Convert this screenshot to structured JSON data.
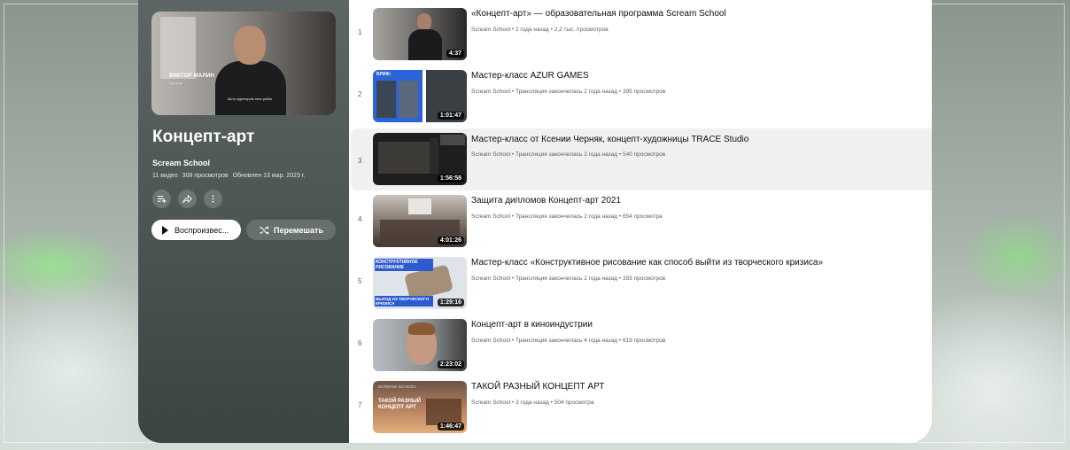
{
  "playlist": {
    "title": "Концепт-арт",
    "channel": "Scream School",
    "video_count": "11 видео",
    "views": "308 просмотров",
    "updated": "Обновлен 13 мар. 2023 г.",
    "hero_name": "ВИКТОР МАЛИН",
    "hero_role": "Куратор",
    "hero_caption": "быть куратором этих ребят",
    "play_label": "Воспроизвес...",
    "shuffle_label": "Перемешать"
  },
  "videos": [
    {
      "index": "1",
      "title": "«Концепт-арт» — образовательная программа Scream School",
      "meta": "Scream School • 2 года назад • 2,2 тыс. просмотров",
      "duration": "4:37"
    },
    {
      "index": "2",
      "title": "Мастер-класс AZUR GAMES",
      "meta": "Scream School • Трансляция закончилась 2 года назад • 395 просмотров",
      "duration": "1:01:47",
      "thumb_text": "БРИФ:"
    },
    {
      "index": "3",
      "title": "Мастер-класс от Ксении Черняк, концепт-художницы TRACE Studio",
      "meta": "Scream School • Трансляция закончилась 2 года назад • 540 просмотров",
      "duration": "1:56:58"
    },
    {
      "index": "4",
      "title": "Защита дипломов Концепт-арт 2021",
      "meta": "Scream School • Трансляция закончилась 2 года назад • 654 просмотра",
      "duration": "4:01:26"
    },
    {
      "index": "5",
      "title": "Мастер-класс «Конструктивное рисование как способ выйти из творческого кризиса»",
      "meta": "Scream School • Трансляция закончилась 2 года назад • 359 просмотров",
      "duration": "1:29:16",
      "thumb_text": "КОНСТРУКТИВНОЕ РИСОВАНИЕ",
      "thumb_text2": "ВЫХОД ИЗ ТВОРЧЕСКОГО КРИЗИСА"
    },
    {
      "index": "6",
      "title": "Концепт-арт в киноиндустрии",
      "meta": "Scream School • Трансляция закончилась 4 года назад • 619 просмотров",
      "duration": "2:23:02"
    },
    {
      "index": "7",
      "title": "ТАКОЙ РАЗНЫЙ КОНЦЕПТ АРТ",
      "meta": "Scream School • 3 года назад • 504 просмотра",
      "duration": "1:46:47",
      "thumb_text": "SCREAM SCHOOL",
      "thumb_text2": "ТАКОЙ РАЗНЫЙ КОНЦЕПТ АРТ"
    }
  ],
  "icons": {
    "save": "add-to-queue-icon",
    "share": "share-icon",
    "more": "more-icon",
    "play": "play-icon",
    "shuffle": "shuffle-icon"
  },
  "colors": {
    "panel": "#4b5452",
    "active_row": "#f0f0f0",
    "text": "#0f0f0f",
    "meta": "#606060"
  }
}
